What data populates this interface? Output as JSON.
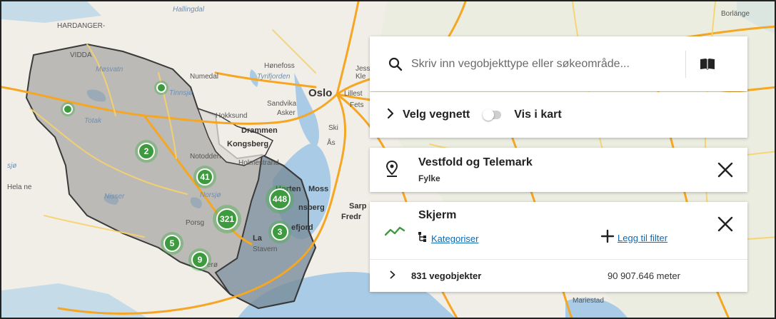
{
  "map": {
    "places": [
      {
        "id": "hardanger",
        "text": "HARDANGER-"
      },
      {
        "id": "vidda",
        "text": "VIDDA"
      },
      {
        "id": "hallingdal",
        "text": "Hallingdal"
      },
      {
        "id": "honefoss",
        "text": "Hønefoss"
      },
      {
        "id": "numedal",
        "text": "Numedal"
      },
      {
        "id": "tyrifjorden",
        "text": "Tyrifjorden"
      },
      {
        "id": "mosvatn",
        "text": "Møsvatn"
      },
      {
        "id": "tinnsjo",
        "text": "Tinnsjø"
      },
      {
        "id": "oslo",
        "text": "Oslo"
      },
      {
        "id": "sandvika",
        "text": "Sandvika"
      },
      {
        "id": "asker",
        "text": "Asker"
      },
      {
        "id": "hokksund",
        "text": "Hokksund"
      },
      {
        "id": "drammen",
        "text": "Drammen"
      },
      {
        "id": "kongsberg",
        "text": "Kongsberg"
      },
      {
        "id": "notodden",
        "text": "Notodden"
      },
      {
        "id": "holmestrand",
        "text": "Holmestrand"
      },
      {
        "id": "totak",
        "text": "Totak"
      },
      {
        "id": "nisser",
        "text": "Nisser"
      },
      {
        "id": "norsjo",
        "text": "Norsjø"
      },
      {
        "id": "horten",
        "text": "Horten"
      },
      {
        "id": "moss",
        "text": "Moss"
      },
      {
        "id": "tonsberg",
        "text": "nsberg"
      },
      {
        "id": "fredrikstad",
        "text": "Fredr"
      },
      {
        "id": "sandefjord",
        "text": "efjord"
      },
      {
        "id": "porsgrunn",
        "text": "Porsg"
      },
      {
        "id": "larvik",
        "text": "La"
      },
      {
        "id": "stavern",
        "text": "Stavern"
      },
      {
        "id": "kragero",
        "text": "erø"
      },
      {
        "id": "helane",
        "text": "Hela ne"
      },
      {
        "id": "sjo",
        "text": "sjø"
      },
      {
        "id": "borlange",
        "text": "Borlänge"
      },
      {
        "id": "mariestad",
        "text": "Mariestad"
      },
      {
        "id": "jess",
        "text": "Jess"
      },
      {
        "id": "kle",
        "text": "Kle"
      },
      {
        "id": "lillestrom",
        "text": "Lillest"
      },
      {
        "id": "fets",
        "text": "Fets"
      },
      {
        "id": "ski",
        "text": "Ski"
      },
      {
        "id": "as",
        "text": "Ås"
      },
      {
        "id": "sarp",
        "text": "Sarp"
      }
    ],
    "clusters": [
      {
        "id": "c2",
        "count": "2"
      },
      {
        "id": "c41",
        "count": "41"
      },
      {
        "id": "c448",
        "count": "448"
      },
      {
        "id": "c321",
        "count": "321"
      },
      {
        "id": "c3",
        "count": "3"
      },
      {
        "id": "c5",
        "count": "5"
      },
      {
        "id": "c9",
        "count": "9"
      }
    ],
    "colors": {
      "region_fill": "#8a8a8a",
      "highlight_fill": "#6e8aa0",
      "cluster": "#3d9a3f",
      "road_major": "#f5a623",
      "road_minor": "#f7d26b",
      "water": "#a9cbe6",
      "land": "#f1eee7"
    }
  },
  "search": {
    "placeholder": "Skriv inn vegobjekttype eller søkeområde...",
    "value": ""
  },
  "vegnett": {
    "label": "Velg vegnett",
    "toggle_label": "Vis i kart",
    "toggle_on": false
  },
  "area_filter": {
    "title": "Vestfold og Telemark",
    "subtitle": "Fylke"
  },
  "object_type": {
    "title": "Skjerm",
    "categorize_label": "Kategoriser",
    "add_filter_label": "Legg til filter",
    "count_label": "831 vegobjekter",
    "length_label": "90 907.646 meter"
  },
  "icons": {
    "search": "search-icon",
    "book": "book-icon",
    "chevron": "chevron-right-icon",
    "pin": "map-pin-icon",
    "close": "close-icon",
    "trend": "trend-line-icon",
    "tree": "category-tree-icon",
    "plus": "plus-icon"
  }
}
